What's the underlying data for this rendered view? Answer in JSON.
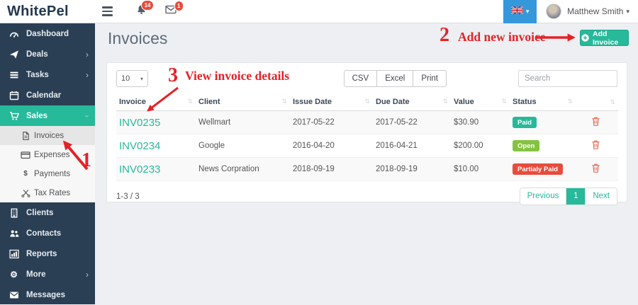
{
  "header": {
    "logo": "WhitePel",
    "bell_badge": "14",
    "mail_badge": "1",
    "user_name": "Matthew Smith"
  },
  "sidebar": {
    "items": [
      {
        "label": "Dashboard"
      },
      {
        "label": "Deals"
      },
      {
        "label": "Tasks"
      },
      {
        "label": "Calendar"
      },
      {
        "label": "Sales"
      },
      {
        "label": "Clients"
      },
      {
        "label": "Contacts"
      },
      {
        "label": "Reports"
      },
      {
        "label": "More"
      },
      {
        "label": "Messages"
      }
    ],
    "sales_submenu": [
      {
        "label": "Invoices"
      },
      {
        "label": "Expenses"
      },
      {
        "label": "Payments"
      },
      {
        "label": "Tax Rates"
      }
    ]
  },
  "page": {
    "title": "Invoices"
  },
  "toolbar": {
    "add_invoice_label": "Add Invoice",
    "page_size": "10",
    "export": [
      "CSV",
      "Excel",
      "Print"
    ],
    "search_placeholder": "Search"
  },
  "table": {
    "columns": [
      "Invoice",
      "Client",
      "Issue Date",
      "Due Date",
      "Value",
      "Status",
      ""
    ],
    "rows": [
      {
        "invoice": "INV0235",
        "client": "Wellmart",
        "issue_date": "2017-05-22",
        "due_date": "2017-05-22",
        "value": "$30.90",
        "status": "Paid",
        "status_color": "#26b99a"
      },
      {
        "invoice": "INV0234",
        "client": "Google",
        "issue_date": "2016-04-20",
        "due_date": "2016-04-21",
        "value": "$200.00",
        "status": "Open",
        "status_color": "#84c340"
      },
      {
        "invoice": "INV0233",
        "client": "News Corpration",
        "issue_date": "2018-09-19",
        "due_date": "2018-09-19",
        "value": "$10.00",
        "status": "Partialy Paid",
        "status_color": "#e74c3c"
      }
    ]
  },
  "pagination": {
    "info": "1-3 / 3",
    "prev_label": "Previous",
    "page": "1",
    "next_label": "Next"
  },
  "annotations": {
    "color": "#e32227",
    "step1": {
      "number": "1"
    },
    "step2": {
      "number": "2",
      "text": "Add new invoice"
    },
    "step3": {
      "number": "3",
      "text": "View invoice details"
    }
  },
  "icons": {
    "sort": "⇅",
    "caret_down": "▾",
    "chevron_right": "›",
    "gear": "⚙",
    "dollar": "$"
  },
  "colors": {
    "accent_teal": "#26b99a",
    "sidebar_navy": "#2a3f54",
    "language_blue": "#3498db",
    "badge_red": "#e74c3c",
    "open_green": "#84c340"
  }
}
